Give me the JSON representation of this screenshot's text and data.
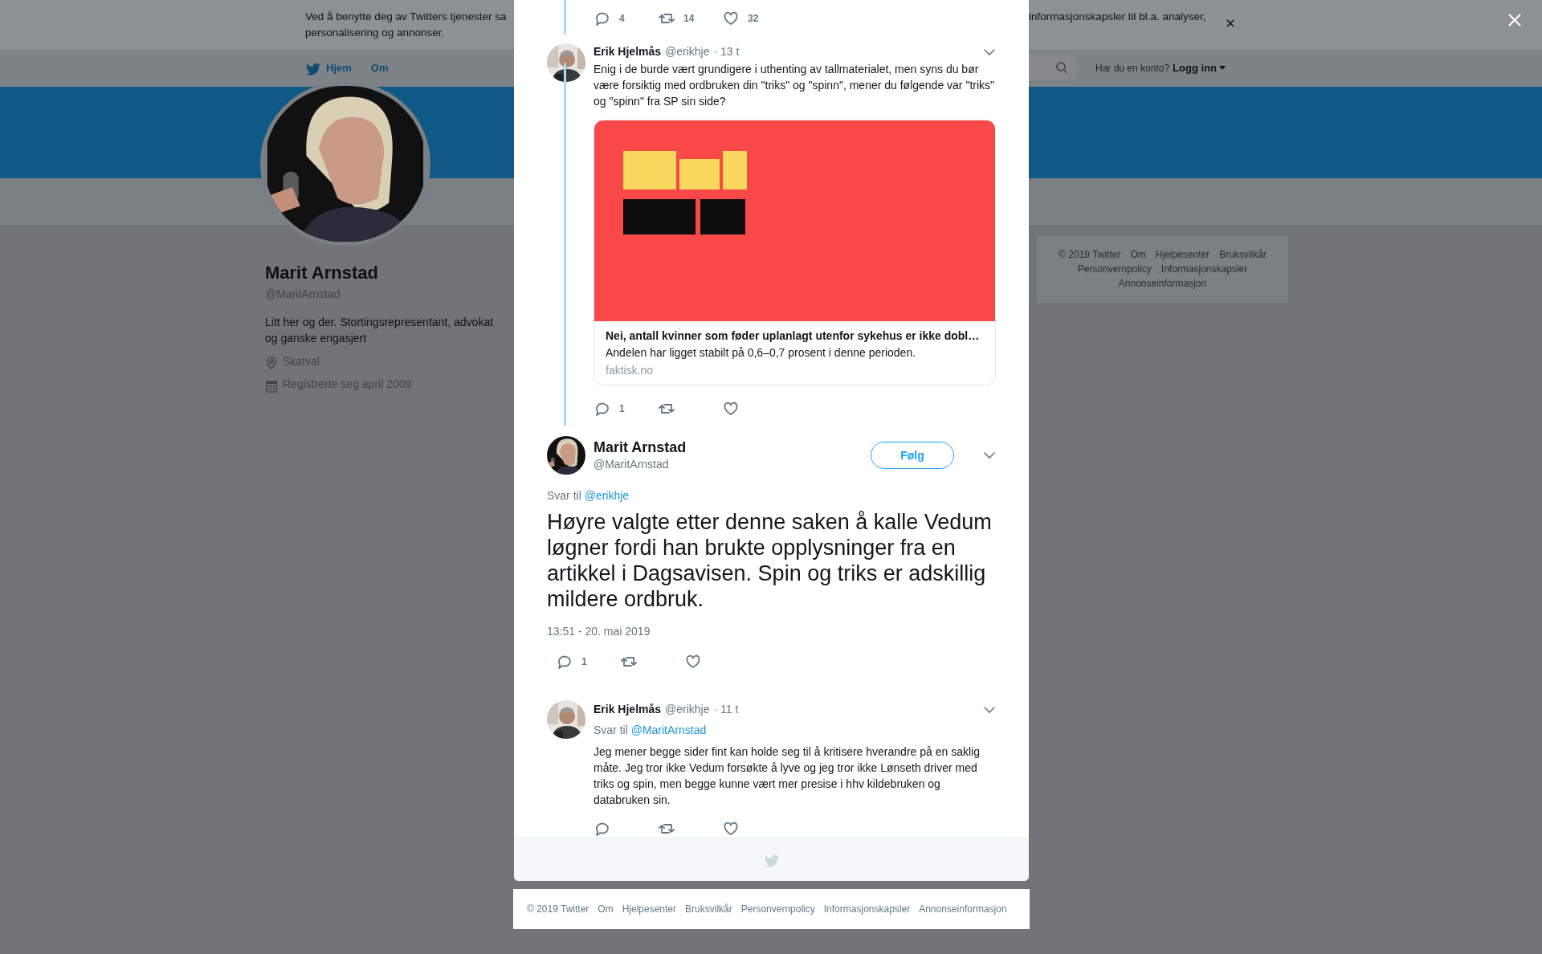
{
  "cookie_banner": {
    "text_left": "Ved å benytte deg av Twitters tjenester sa",
    "text_right": "informasjonskapsler til bl.a. analyser,",
    "text_line2": "personalisering og annonser."
  },
  "nav": {
    "items": [
      {
        "label": "Hjem",
        "kind": "home"
      },
      {
        "label": "Om",
        "kind": "plain"
      }
    ],
    "account_prompt": "Har du en konto?",
    "login": "Logg inn"
  },
  "profile": {
    "name": "Marit Arnstad",
    "handle": "@MaritArnstad",
    "bio": "Litt her og der. Stortingsrepresentant, advokat og ganske engasjert",
    "location": "Skatval",
    "joined": "Registrerte seg april 2009"
  },
  "side_footer": {
    "links": [
      "© 2019 Twitter",
      "Om",
      "Hjelpesenter",
      "Bruksvilkår",
      "Personvernpolicy",
      "Informasjonskapsler",
      "Annonseinformasjon"
    ]
  },
  "modal": {
    "top_actions": [
      {
        "kind": "reply",
        "count": "4"
      },
      {
        "kind": "retweet",
        "count": "14"
      },
      {
        "kind": "like",
        "count": "32"
      }
    ],
    "parent_tweet": {
      "name": "Erik Hjelmås",
      "handle": "@erikhje",
      "time": "· 13 t",
      "text": "Enig i de burde vært grundigere i uthenting av tallmaterialet, men syns du bør være forsiktig med ordbruken din \"triks\" og \"spinn\", mener du følgende var \"triks\" og \"spinn\" fra SP sin side?",
      "card": {
        "title": "Nei, antall kvinner som føder uplanlagt utenfor sykehus er ikke dobl…",
        "description": "Andelen har ligget stabilt på 0,6–0,7 prosent i denne perioden.",
        "domain": "faktisk.no"
      },
      "actions": [
        {
          "kind": "reply",
          "count": "1"
        },
        {
          "kind": "retweet"
        },
        {
          "kind": "like"
        }
      ]
    },
    "main_tweet": {
      "name": "Marit Arnstad",
      "handle": "@MaritArnstad",
      "follow": "Følg",
      "reply_to_label": "Svar til",
      "reply_to": "@erikhje",
      "text": "Høyre valgte etter denne saken å kalle Vedum løgner fordi han brukte opplysninger fra en artikkel i Dagsavisen. Spin og triks er adskillig mildere ordbruk.",
      "timestamp": "13:51 - 20. mai 2019",
      "actions": [
        {
          "kind": "reply",
          "count": "1"
        },
        {
          "kind": "retweet"
        },
        {
          "kind": "like"
        }
      ]
    },
    "reply": {
      "name": "Erik Hjelmås",
      "handle": "@erikhje",
      "time": "· 11 t",
      "reply_to_label": "Svar til",
      "reply_to": "@MaritArnstad",
      "text": "Jeg mener begge sider fint kan holde seg til å kritisere hverandre på en saklig måte. Jeg tror ikke Vedum forsøkte å lyve og jeg tror ikke Lønseth driver med triks og spin, men begge kunne vært mer presise i hhv kildebruken og databruken sin.",
      "actions": [
        {
          "kind": "reply"
        },
        {
          "kind": "retweet"
        },
        {
          "kind": "like"
        }
      ]
    }
  },
  "footer": {
    "links": [
      "© 2019 Twitter",
      "Om",
      "Hjelpesenter",
      "Bruksvilkår",
      "Personvernpolicy",
      "Informasjonskapsler",
      "Annonseinformasjon"
    ]
  }
}
